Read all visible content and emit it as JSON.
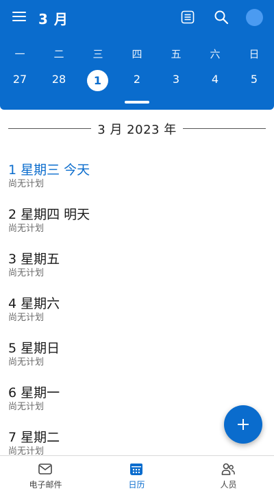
{
  "header": {
    "month_title": "3 月",
    "weekdays": [
      "一",
      "二",
      "三",
      "四",
      "五",
      "六",
      "日"
    ],
    "dates": [
      "27",
      "28",
      "1",
      "2",
      "3",
      "4",
      "5"
    ],
    "selected_date": "1"
  },
  "agenda": {
    "month_label": "3 月 2023 年",
    "days": [
      {
        "title": "1 星期三  今天",
        "subtitle": "尚无计划"
      },
      {
        "title": "2 星期四  明天",
        "subtitle": "尚无计划"
      },
      {
        "title": "3 星期五",
        "subtitle": "尚无计划"
      },
      {
        "title": "4 星期六",
        "subtitle": "尚无计划"
      },
      {
        "title": "5 星期日",
        "subtitle": "尚无计划"
      },
      {
        "title": "6 星期一",
        "subtitle": "尚无计划"
      },
      {
        "title": "7 星期二",
        "subtitle": "尚无计划"
      }
    ]
  },
  "bottom_nav": {
    "tabs": [
      {
        "label": "电子邮件",
        "icon": "mail-icon"
      },
      {
        "label": "日历",
        "icon": "calendar-icon"
      },
      {
        "label": "人员",
        "icon": "people-icon"
      }
    ],
    "active_tab": "日历"
  },
  "colors": {
    "accent": "#0a6ccd",
    "header_bg": "#0a6ccd",
    "avatar": "#4b9bf1",
    "text": "#1a1a1a",
    "subtext": "#6b6b6b"
  }
}
